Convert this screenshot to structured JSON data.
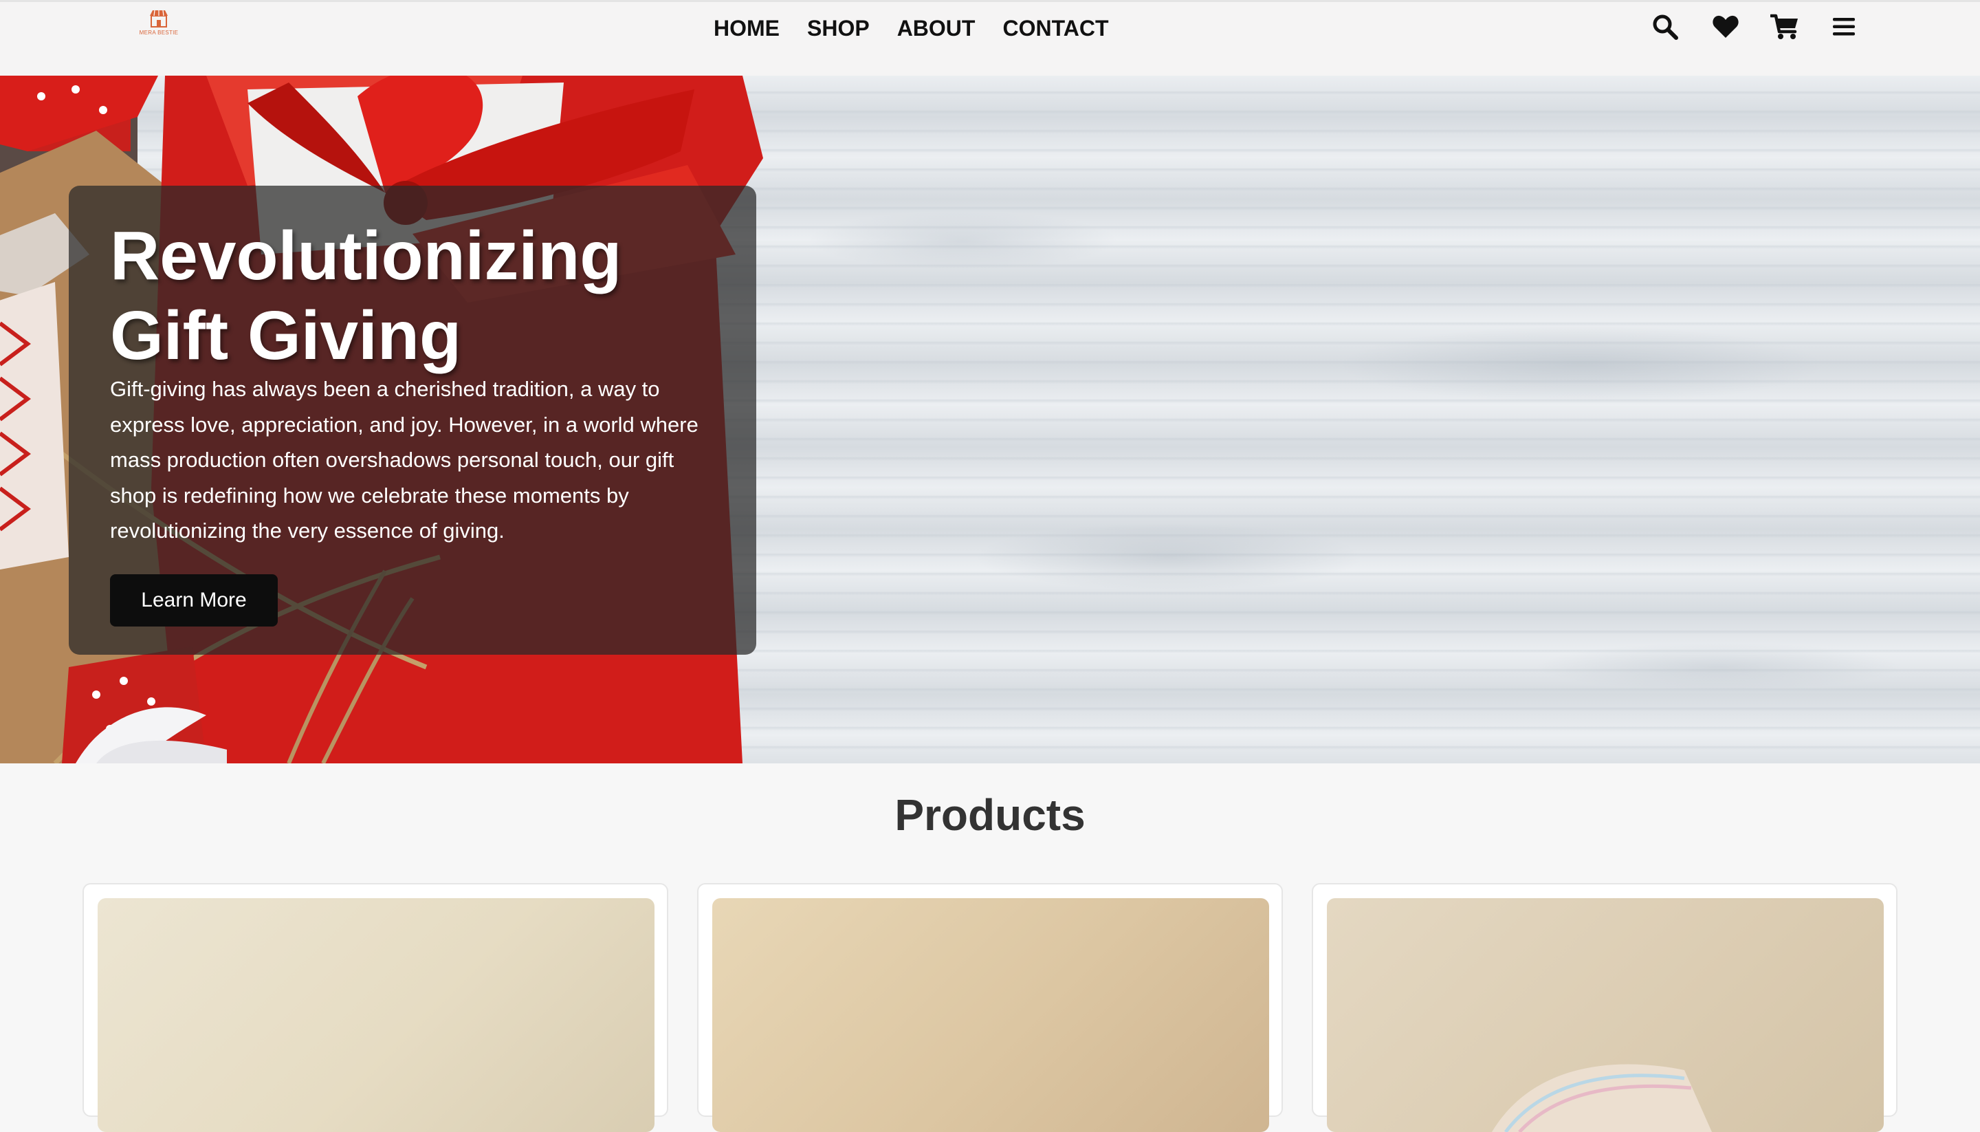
{
  "brand": {
    "logo_text": "MERA BESTIE",
    "logo_color": "#d9653a"
  },
  "nav": {
    "links": [
      "HOME",
      "SHOP",
      "ABOUT",
      "CONTACT"
    ],
    "icons": [
      "search-icon",
      "heart-icon",
      "cart-icon",
      "menu-icon"
    ]
  },
  "hero": {
    "title": "Revolutionizing Gift Giving",
    "text": "Gift-giving has always been a cherished tradition, a way to express love, appreciation, and joy. However, in a world where mass production often overshadows personal touch, our gift shop is redefining how we celebrate these moments by revolutionizing the very essence of giving.",
    "button_label": "Learn More",
    "gift_color": "#d8201c"
  },
  "products": {
    "title": "Products",
    "items": [
      {
        "name": "product-1",
        "tone": "#e8e0cc"
      },
      {
        "name": "product-2",
        "tone": "#dcc7a3"
      },
      {
        "name": "product-3",
        "tone": "#d8cab0"
      }
    ]
  }
}
